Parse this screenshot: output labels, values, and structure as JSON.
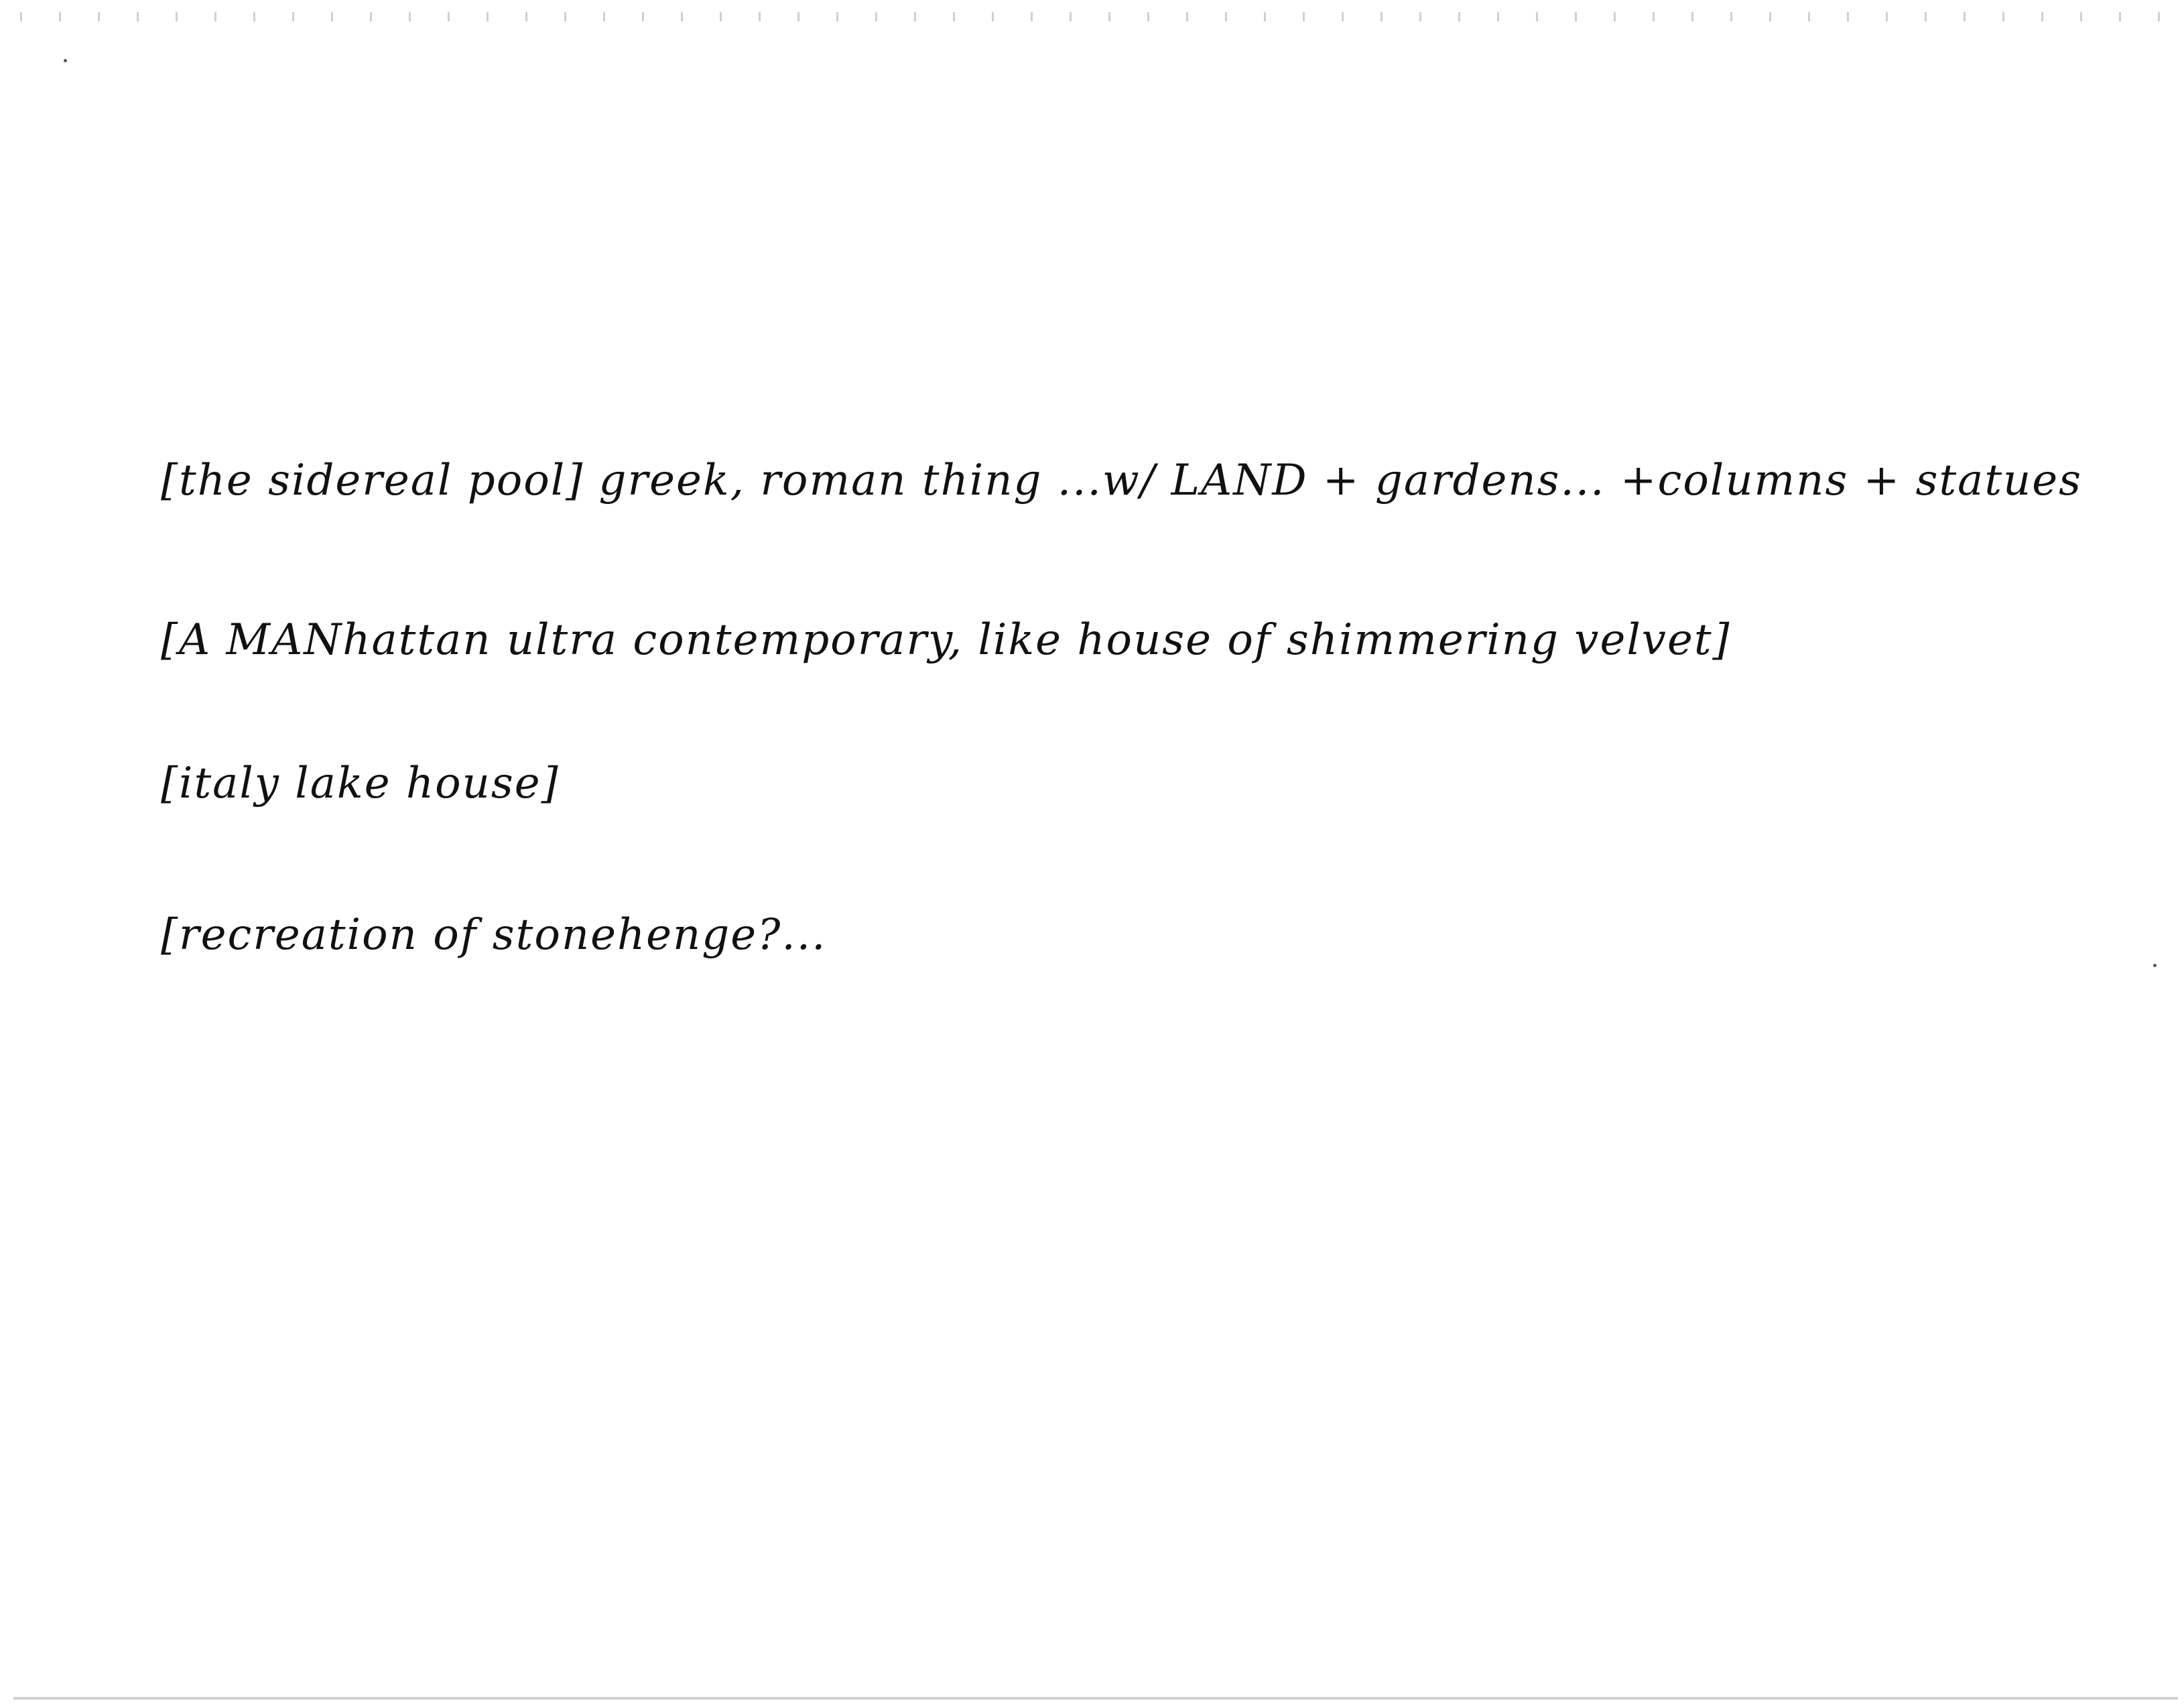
{
  "notes": {
    "lines": [
      "[the sidereal pool] greek, roman thing ...w/ LAND + gardens... +columns + statues",
      "[A MANhattan ultra contemporary, like house of shimmering velvet]",
      "[italy lake house]",
      "[recreation of stonehenge?..."
    ]
  }
}
